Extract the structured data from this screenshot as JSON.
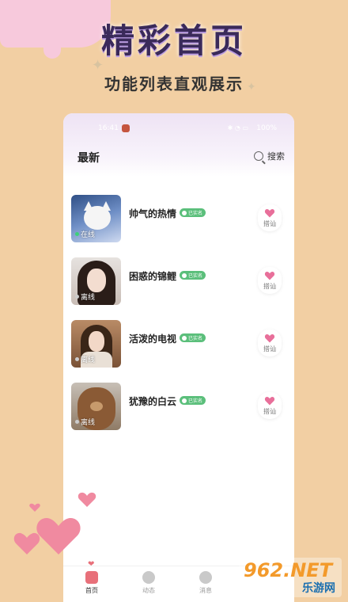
{
  "banner": {
    "title": "精彩首页",
    "subtitle": "功能列表直观展示"
  },
  "status_bar": {
    "time": "16:41",
    "battery": "100%"
  },
  "header": {
    "title": "最新",
    "search_label": "搜索"
  },
  "users": [
    {
      "name": "帅气的热情",
      "badge": "已实名",
      "status": "在线",
      "status_color": "#3dd07a",
      "action": "搭讪"
    },
    {
      "name": "困惑的锦鲤",
      "badge": "已实名",
      "status": "离线",
      "status_color": "#bbbbbb",
      "action": "搭讪"
    },
    {
      "name": "活泼的电视",
      "badge": "已实名",
      "status": "离线",
      "status_color": "#bbbbbb",
      "action": "搭讪"
    },
    {
      "name": "犹豫的白云",
      "badge": "已实名",
      "status": "离线",
      "status_color": "#bbbbbb",
      "action": "搭讪"
    }
  ],
  "nav": [
    {
      "label": "首页",
      "icon": "home-icon",
      "active": true
    },
    {
      "label": "动态",
      "icon": "compass-icon",
      "active": false
    },
    {
      "label": "消息",
      "icon": "message-icon",
      "active": false
    }
  ],
  "watermark": {
    "top": "962.NET",
    "bottom": "乐游网"
  },
  "colors": {
    "background": "#f2cfa3",
    "accent_pink": "#e8707a",
    "verified_green": "#5bbf7b"
  }
}
